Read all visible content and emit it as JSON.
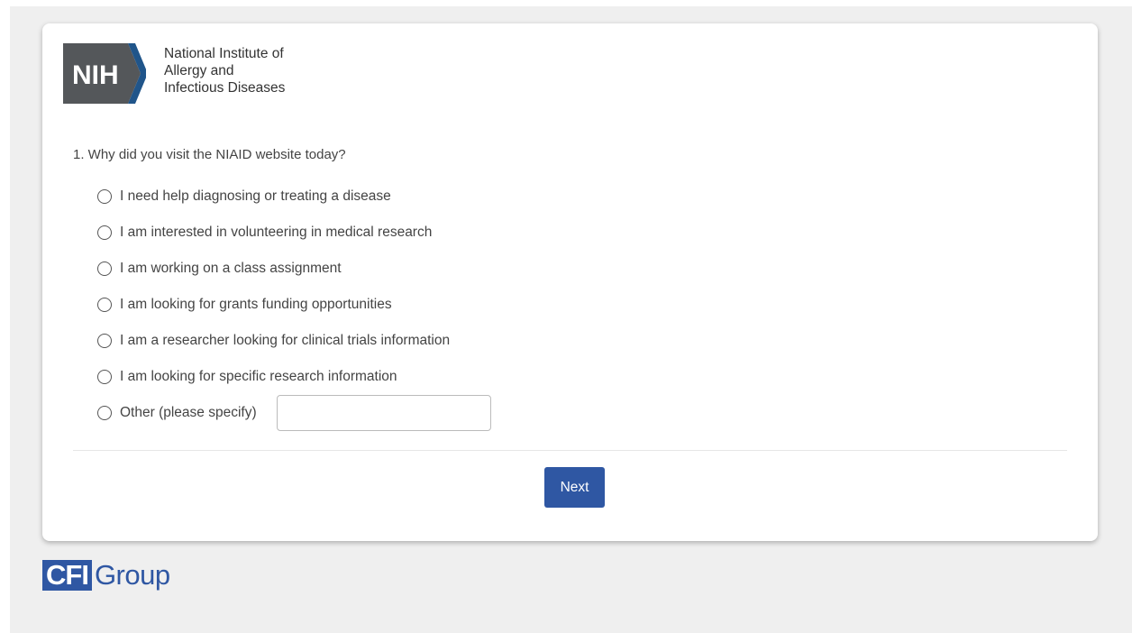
{
  "header": {
    "logo_letters": "NIH",
    "org_lines": [
      "National Institute of",
      "Allergy and",
      "Infectious Diseases"
    ]
  },
  "survey": {
    "question": "1. Why did you visit the NIAID website today?",
    "options": [
      "I need help diagnosing or treating a disease",
      "I am interested in volunteering in medical research",
      "I am working on a class assignment",
      "I am looking for grants funding opportunities",
      "I am a researcher looking for clinical trials information",
      "I am looking for specific research information",
      "Other (please specify)"
    ],
    "other_value": "",
    "next_label": "Next"
  },
  "footer": {
    "brand_box": "CFI",
    "brand_word": "Group"
  },
  "colors": {
    "accent": "#2f57a3",
    "nih_gray": "#54575a",
    "nih_blue": "#20558a"
  }
}
